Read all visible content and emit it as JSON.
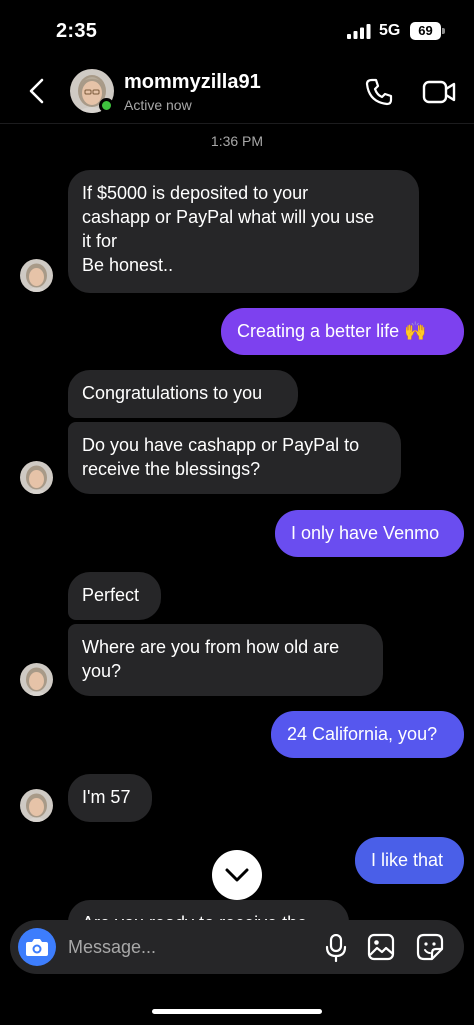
{
  "status_bar": {
    "time": "2:35",
    "network": "5G",
    "battery": "69"
  },
  "header": {
    "contact_name": "mommyzilla91",
    "status": "Active now"
  },
  "timestamp": "1:36 PM",
  "messages": [
    {
      "direction": "in",
      "lines": [
        "If $5000 is deposited to your",
        "cashapp or PayPal what will you use",
        "it for",
        "Be honest.."
      ]
    },
    {
      "direction": "out",
      "text": "Creating a better life 🙌"
    },
    {
      "direction": "in",
      "lines": [
        "Congratulations to you"
      ]
    },
    {
      "direction": "in",
      "lines": [
        "Do you have cashapp or PayPal to",
        "receive the blessings?"
      ]
    },
    {
      "direction": "out",
      "text": "I only have Venmo"
    },
    {
      "direction": "in",
      "lines": [
        "Perfect"
      ]
    },
    {
      "direction": "in",
      "lines": [
        "Where are you from how old are",
        "you?"
      ]
    },
    {
      "direction": "out",
      "text": "24 California, you?"
    },
    {
      "direction": "in",
      "lines": [
        "I'm 57"
      ]
    },
    {
      "direction": "out",
      "text": "I like that"
    },
    {
      "direction": "in",
      "lines": [
        "Are you ready to receive the"
      ]
    }
  ],
  "composer": {
    "placeholder": "Message..."
  },
  "colors": {
    "outgoing_top": "#8a3ff0",
    "outgoing_bottom": "#4a5fe8",
    "incoming": "#262628",
    "online": "#3ec13e",
    "camera": "#3d7dfc"
  },
  "icons": [
    "back-chevron-icon",
    "phone-icon",
    "video-camera-icon",
    "chevron-down-icon",
    "camera-icon",
    "microphone-icon",
    "gallery-icon",
    "sticker-icon"
  ]
}
